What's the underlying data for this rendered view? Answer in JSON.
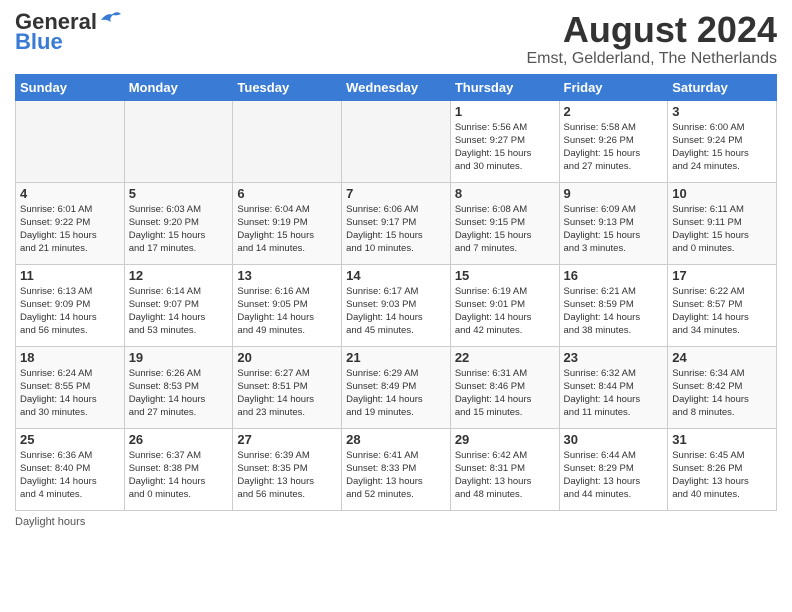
{
  "header": {
    "logo_line1": "General",
    "logo_line2": "Blue",
    "month_year": "August 2024",
    "location": "Emst, Gelderland, The Netherlands"
  },
  "weekdays": [
    "Sunday",
    "Monday",
    "Tuesday",
    "Wednesday",
    "Thursday",
    "Friday",
    "Saturday"
  ],
  "weeks": [
    [
      {
        "day": "",
        "info": ""
      },
      {
        "day": "",
        "info": ""
      },
      {
        "day": "",
        "info": ""
      },
      {
        "day": "",
        "info": ""
      },
      {
        "day": "1",
        "info": "Sunrise: 5:56 AM\nSunset: 9:27 PM\nDaylight: 15 hours\nand 30 minutes."
      },
      {
        "day": "2",
        "info": "Sunrise: 5:58 AM\nSunset: 9:26 PM\nDaylight: 15 hours\nand 27 minutes."
      },
      {
        "day": "3",
        "info": "Sunrise: 6:00 AM\nSunset: 9:24 PM\nDaylight: 15 hours\nand 24 minutes."
      }
    ],
    [
      {
        "day": "4",
        "info": "Sunrise: 6:01 AM\nSunset: 9:22 PM\nDaylight: 15 hours\nand 21 minutes."
      },
      {
        "day": "5",
        "info": "Sunrise: 6:03 AM\nSunset: 9:20 PM\nDaylight: 15 hours\nand 17 minutes."
      },
      {
        "day": "6",
        "info": "Sunrise: 6:04 AM\nSunset: 9:19 PM\nDaylight: 15 hours\nand 14 minutes."
      },
      {
        "day": "7",
        "info": "Sunrise: 6:06 AM\nSunset: 9:17 PM\nDaylight: 15 hours\nand 10 minutes."
      },
      {
        "day": "8",
        "info": "Sunrise: 6:08 AM\nSunset: 9:15 PM\nDaylight: 15 hours\nand 7 minutes."
      },
      {
        "day": "9",
        "info": "Sunrise: 6:09 AM\nSunset: 9:13 PM\nDaylight: 15 hours\nand 3 minutes."
      },
      {
        "day": "10",
        "info": "Sunrise: 6:11 AM\nSunset: 9:11 PM\nDaylight: 15 hours\nand 0 minutes."
      }
    ],
    [
      {
        "day": "11",
        "info": "Sunrise: 6:13 AM\nSunset: 9:09 PM\nDaylight: 14 hours\nand 56 minutes."
      },
      {
        "day": "12",
        "info": "Sunrise: 6:14 AM\nSunset: 9:07 PM\nDaylight: 14 hours\nand 53 minutes."
      },
      {
        "day": "13",
        "info": "Sunrise: 6:16 AM\nSunset: 9:05 PM\nDaylight: 14 hours\nand 49 minutes."
      },
      {
        "day": "14",
        "info": "Sunrise: 6:17 AM\nSunset: 9:03 PM\nDaylight: 14 hours\nand 45 minutes."
      },
      {
        "day": "15",
        "info": "Sunrise: 6:19 AM\nSunset: 9:01 PM\nDaylight: 14 hours\nand 42 minutes."
      },
      {
        "day": "16",
        "info": "Sunrise: 6:21 AM\nSunset: 8:59 PM\nDaylight: 14 hours\nand 38 minutes."
      },
      {
        "day": "17",
        "info": "Sunrise: 6:22 AM\nSunset: 8:57 PM\nDaylight: 14 hours\nand 34 minutes."
      }
    ],
    [
      {
        "day": "18",
        "info": "Sunrise: 6:24 AM\nSunset: 8:55 PM\nDaylight: 14 hours\nand 30 minutes."
      },
      {
        "day": "19",
        "info": "Sunrise: 6:26 AM\nSunset: 8:53 PM\nDaylight: 14 hours\nand 27 minutes."
      },
      {
        "day": "20",
        "info": "Sunrise: 6:27 AM\nSunset: 8:51 PM\nDaylight: 14 hours\nand 23 minutes."
      },
      {
        "day": "21",
        "info": "Sunrise: 6:29 AM\nSunset: 8:49 PM\nDaylight: 14 hours\nand 19 minutes."
      },
      {
        "day": "22",
        "info": "Sunrise: 6:31 AM\nSunset: 8:46 PM\nDaylight: 14 hours\nand 15 minutes."
      },
      {
        "day": "23",
        "info": "Sunrise: 6:32 AM\nSunset: 8:44 PM\nDaylight: 14 hours\nand 11 minutes."
      },
      {
        "day": "24",
        "info": "Sunrise: 6:34 AM\nSunset: 8:42 PM\nDaylight: 14 hours\nand 8 minutes."
      }
    ],
    [
      {
        "day": "25",
        "info": "Sunrise: 6:36 AM\nSunset: 8:40 PM\nDaylight: 14 hours\nand 4 minutes."
      },
      {
        "day": "26",
        "info": "Sunrise: 6:37 AM\nSunset: 8:38 PM\nDaylight: 14 hours\nand 0 minutes."
      },
      {
        "day": "27",
        "info": "Sunrise: 6:39 AM\nSunset: 8:35 PM\nDaylight: 13 hours\nand 56 minutes."
      },
      {
        "day": "28",
        "info": "Sunrise: 6:41 AM\nSunset: 8:33 PM\nDaylight: 13 hours\nand 52 minutes."
      },
      {
        "day": "29",
        "info": "Sunrise: 6:42 AM\nSunset: 8:31 PM\nDaylight: 13 hours\nand 48 minutes."
      },
      {
        "day": "30",
        "info": "Sunrise: 6:44 AM\nSunset: 8:29 PM\nDaylight: 13 hours\nand 44 minutes."
      },
      {
        "day": "31",
        "info": "Sunrise: 6:45 AM\nSunset: 8:26 PM\nDaylight: 13 hours\nand 40 minutes."
      }
    ]
  ],
  "footer": {
    "note": "Daylight hours"
  }
}
